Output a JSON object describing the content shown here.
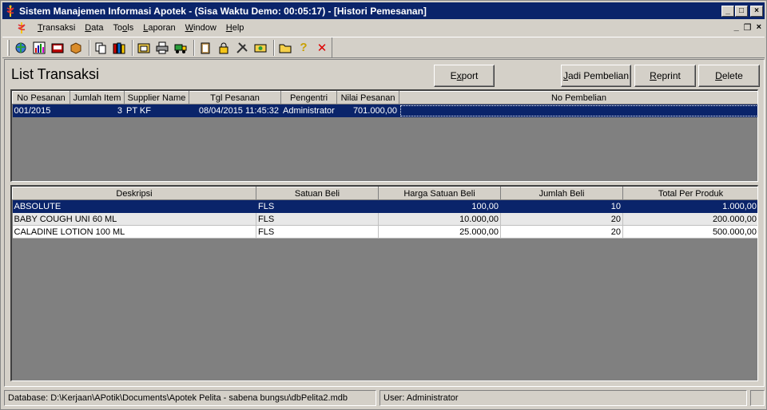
{
  "window": {
    "title": "Sistem Manajemen Informasi Apotek - (Sisa Waktu Demo: 00:05:17) - [Histori Pemesanan]",
    "buttons": {
      "minimize": "_",
      "maximize": "□",
      "close": "×"
    }
  },
  "menu": {
    "items": [
      {
        "pre": "",
        "ul": "T",
        "post": "ransaksi"
      },
      {
        "pre": "",
        "ul": "D",
        "post": "ata"
      },
      {
        "pre": "To",
        "ul": "o",
        "post": "ls"
      },
      {
        "pre": "",
        "ul": "L",
        "post": "aporan"
      },
      {
        "pre": "",
        "ul": "W",
        "post": "indow"
      },
      {
        "pre": "",
        "ul": "H",
        "post": "elp"
      }
    ],
    "mdi_controls": {
      "minimize": "_",
      "restore": "🗗",
      "close": "×"
    }
  },
  "toolbar": {
    "icons": [
      "globe-icon",
      "chart-icon",
      "register-icon",
      "box-icon",
      "copy-icon",
      "books-icon",
      "folder-icon",
      "printer-icon",
      "truck-icon",
      "clipboard-icon",
      "lock-icon",
      "tools-icon",
      "cash-icon",
      "open-folder-icon",
      "help-icon",
      "exit-icon"
    ]
  },
  "page": {
    "title": "List Transaksi",
    "buttons": {
      "export": {
        "pre": "E",
        "ul": "x",
        "post": "port"
      },
      "jadi": {
        "pre": "",
        "ul": "J",
        "post": "adi Pembelian"
      },
      "reprint": {
        "pre": "",
        "ul": "R",
        "post": "eprint"
      },
      "delete": {
        "pre": "",
        "ul": "D",
        "post": "elete"
      }
    }
  },
  "orders_table": {
    "columns": [
      "No Pesanan",
      "Jumlah Item",
      "Supplier Name",
      "Tgl Pesanan",
      "Pengentri",
      "Nilai Pesanan",
      "No Pembelian"
    ],
    "rows": [
      {
        "no_pesanan": "001/2015",
        "jumlah_item": "3",
        "supplier": "PT KF",
        "tgl": "08/04/2015 11:45:32",
        "pengentri": "Administrator",
        "nilai": "701.000,00",
        "no_pembelian": ""
      }
    ]
  },
  "detail_table": {
    "columns": [
      "Deskripsi",
      "Satuan Beli",
      "Harga Satuan Beli",
      "Jumlah Beli",
      "Total Per Produk"
    ],
    "rows": [
      {
        "deskripsi": "ABSOLUTE",
        "satuan": "FLS",
        "harga": "100,00",
        "jumlah": "10",
        "total": "1.000,00"
      },
      {
        "deskripsi": "BABY COUGH UNI 60 ML",
        "satuan": "FLS",
        "harga": "10.000,00",
        "jumlah": "20",
        "total": "200.000,00"
      },
      {
        "deskripsi": "CALADINE LOTION 100 ML",
        "satuan": "FLS",
        "harga": "25.000,00",
        "jumlah": "20",
        "total": "500.000,00"
      }
    ]
  },
  "status": {
    "database": "Database:  D:\\Kerjaan\\APotik\\Documents\\Apotek Pelita - sabena bungsu\\dbPelita2.mdb",
    "user": "User:  Administrator"
  }
}
